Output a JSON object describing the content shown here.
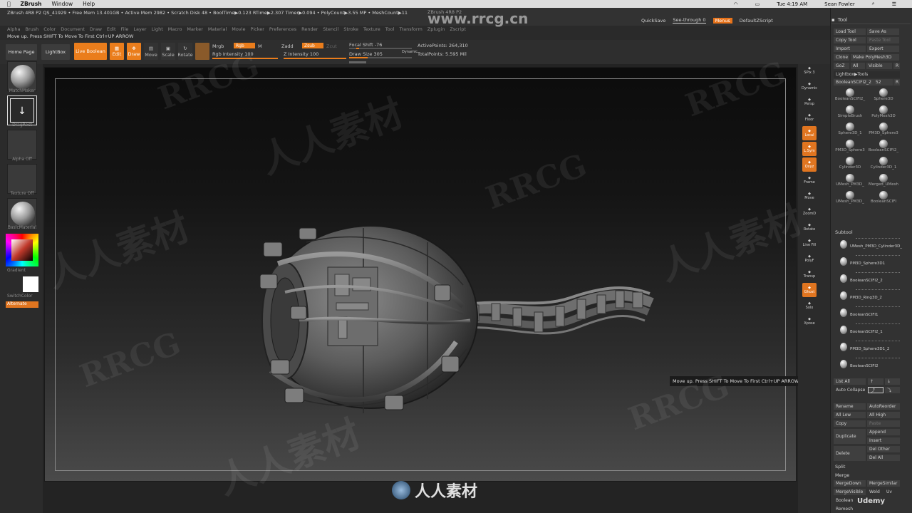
{
  "mac": {
    "app": "ZBrush",
    "menu": [
      "Window",
      "Help"
    ],
    "time": "Tue 4:19 AM",
    "user": "Sean Fowler"
  },
  "zbrush": {
    "title": "ZBrush 4R8 P2",
    "info": "ZBrush 4R8 P2  QS_41929   • Free Mem 13.401GB • Active Mem 2982 • Scratch Disk 48 •  BoolTime▶0.123 RTime▶2.307 Timer▶0.094 • PolyCount▶3.55 MP  • MeshCount▶11",
    "menus": [
      "Alpha",
      "Brush",
      "Color",
      "Document",
      "Draw",
      "Edit",
      "File",
      "Layer",
      "Light",
      "Macro",
      "Marker",
      "Material",
      "Movie",
      "Picker",
      "Preferences",
      "Render",
      "Stencil",
      "Stroke",
      "Texture",
      "Tool",
      "Transform",
      "Zplugin",
      "Zscript"
    ],
    "quicksave": "QuickSave",
    "seethrough": "See-through  0",
    "menus_btn": "Menus",
    "default_script": "DefaultZScript",
    "note": "Move up. Press SHIFT To Move To First  Ctrl+UP ARROW"
  },
  "toolbar": {
    "home": "Home Page",
    "lightbox": "LightBox",
    "live_boolean": "Live Boolean",
    "edit": "Edit",
    "draw": "Draw",
    "move": "Move",
    "scale": "Scale",
    "rotate": "Rotate",
    "mrgb": "Mrgb",
    "rgb": "Rgb",
    "m": "M",
    "zadd": "Zadd",
    "zsub": "Zsub",
    "zcut": "Zcut",
    "rgb_intensity": "Rgb Intensity 100",
    "z_intensity": "Z Intensity 100",
    "focal_shift": "Focal Shift -76",
    "draw_size": "Draw Size 305",
    "dynamic": "Dynamic",
    "active_points": "ActivePoints: 264,310",
    "total_points": "TotalPoints: 5.595 Mil",
    "rgb_intensity_value": 1,
    "z_intensity_value": 1,
    "draw_size_value": 0.3
  },
  "left_shelf": {
    "matchmaker": "MatchMaker",
    "dragrect": "DragRect",
    "alpha": "Alpha Off",
    "texture": "Texture Off",
    "material": "BasicMaterial",
    "gradient": "Gradient",
    "switchcolor": "SwitchColor",
    "alternate": "Alternate"
  },
  "right_shelf": [
    "SPix 3",
    "Dynamic",
    "Persp",
    "Floor",
    "Local",
    "L.Sym",
    "Qxyz",
    "Frame",
    "Move",
    "ZoomD",
    "Rotate",
    "Line Fill",
    "PolyF",
    "Transp",
    "Ghost",
    "Solo",
    "Xpose"
  ],
  "tooltip": "Move up. Press SHIFT To Move To First  Ctrl+UP ARROW",
  "tool_palette": {
    "header": "Tool",
    "buttons": {
      "load": "Load Tool",
      "save": "Save As",
      "copy": "Copy Tool",
      "paste": "Paste Tool",
      "import": "Import",
      "export": "Export",
      "clone": "Clone",
      "make_poly": "Make PolyMesh3D",
      "goz": "GoZ",
      "all": "All",
      "visible": "Visible",
      "r": "R",
      "lightbox_tools": "Lightbox▶Tools",
      "current": "BooleanSCIFI2_2",
      "current_count": "52"
    },
    "tiles": [
      "BooleanSCIFI2_",
      "Sphere3D",
      "SimpleBrush",
      "PolyMesh3D",
      "Sphere3D_1",
      "PM3D_Sphere3",
      "PM3D_Sphere3",
      "BooleanSCIFI2_",
      "Cylinder3D",
      "Cylinder3D_1",
      "UMesh_PM3D_",
      "Merged_UMesh",
      "UMesh_PM3D_",
      "BooleanSCIFI"
    ],
    "subtool_header": "Subtool",
    "subtools": [
      "UMesh_PM3D_Cylinder3D_",
      "PM3D_Sphere3D1",
      "BooleanSCIFI2_2",
      "PM3D_Ring3D_2",
      "BooleanSCIFI1",
      "BooleanSCIFI2_1",
      "PM3D_Sphere3D1_2",
      "BooleanSCIFI2"
    ],
    "list_all": "List All",
    "auto_collapse": "Auto Collapse",
    "actions": {
      "rename": "Rename",
      "autoreorder": "AutoReorder",
      "all_low": "All Low",
      "all_high": "All High",
      "copy": "Copy",
      "paste": "Paste",
      "duplicate": "Duplicate",
      "append": "Append",
      "insert": "Insert",
      "delete": "Delete",
      "del_other": "Del Other",
      "del_all": "Del All",
      "split": "Split",
      "merge": "Merge",
      "merge_down": "MergeDown",
      "merge_similar": "MergeSimilar",
      "merge_visible": "MergeVisible",
      "weld": "Weld",
      "uv": "Uv",
      "boolean": "Boolean",
      "remesh": "Remesh"
    }
  },
  "watermarks": {
    "site": "www.rrcg.cn",
    "latin": "RRCG",
    "cn": "人人素材",
    "logo": "人人素材",
    "udemy": "Udemy"
  }
}
